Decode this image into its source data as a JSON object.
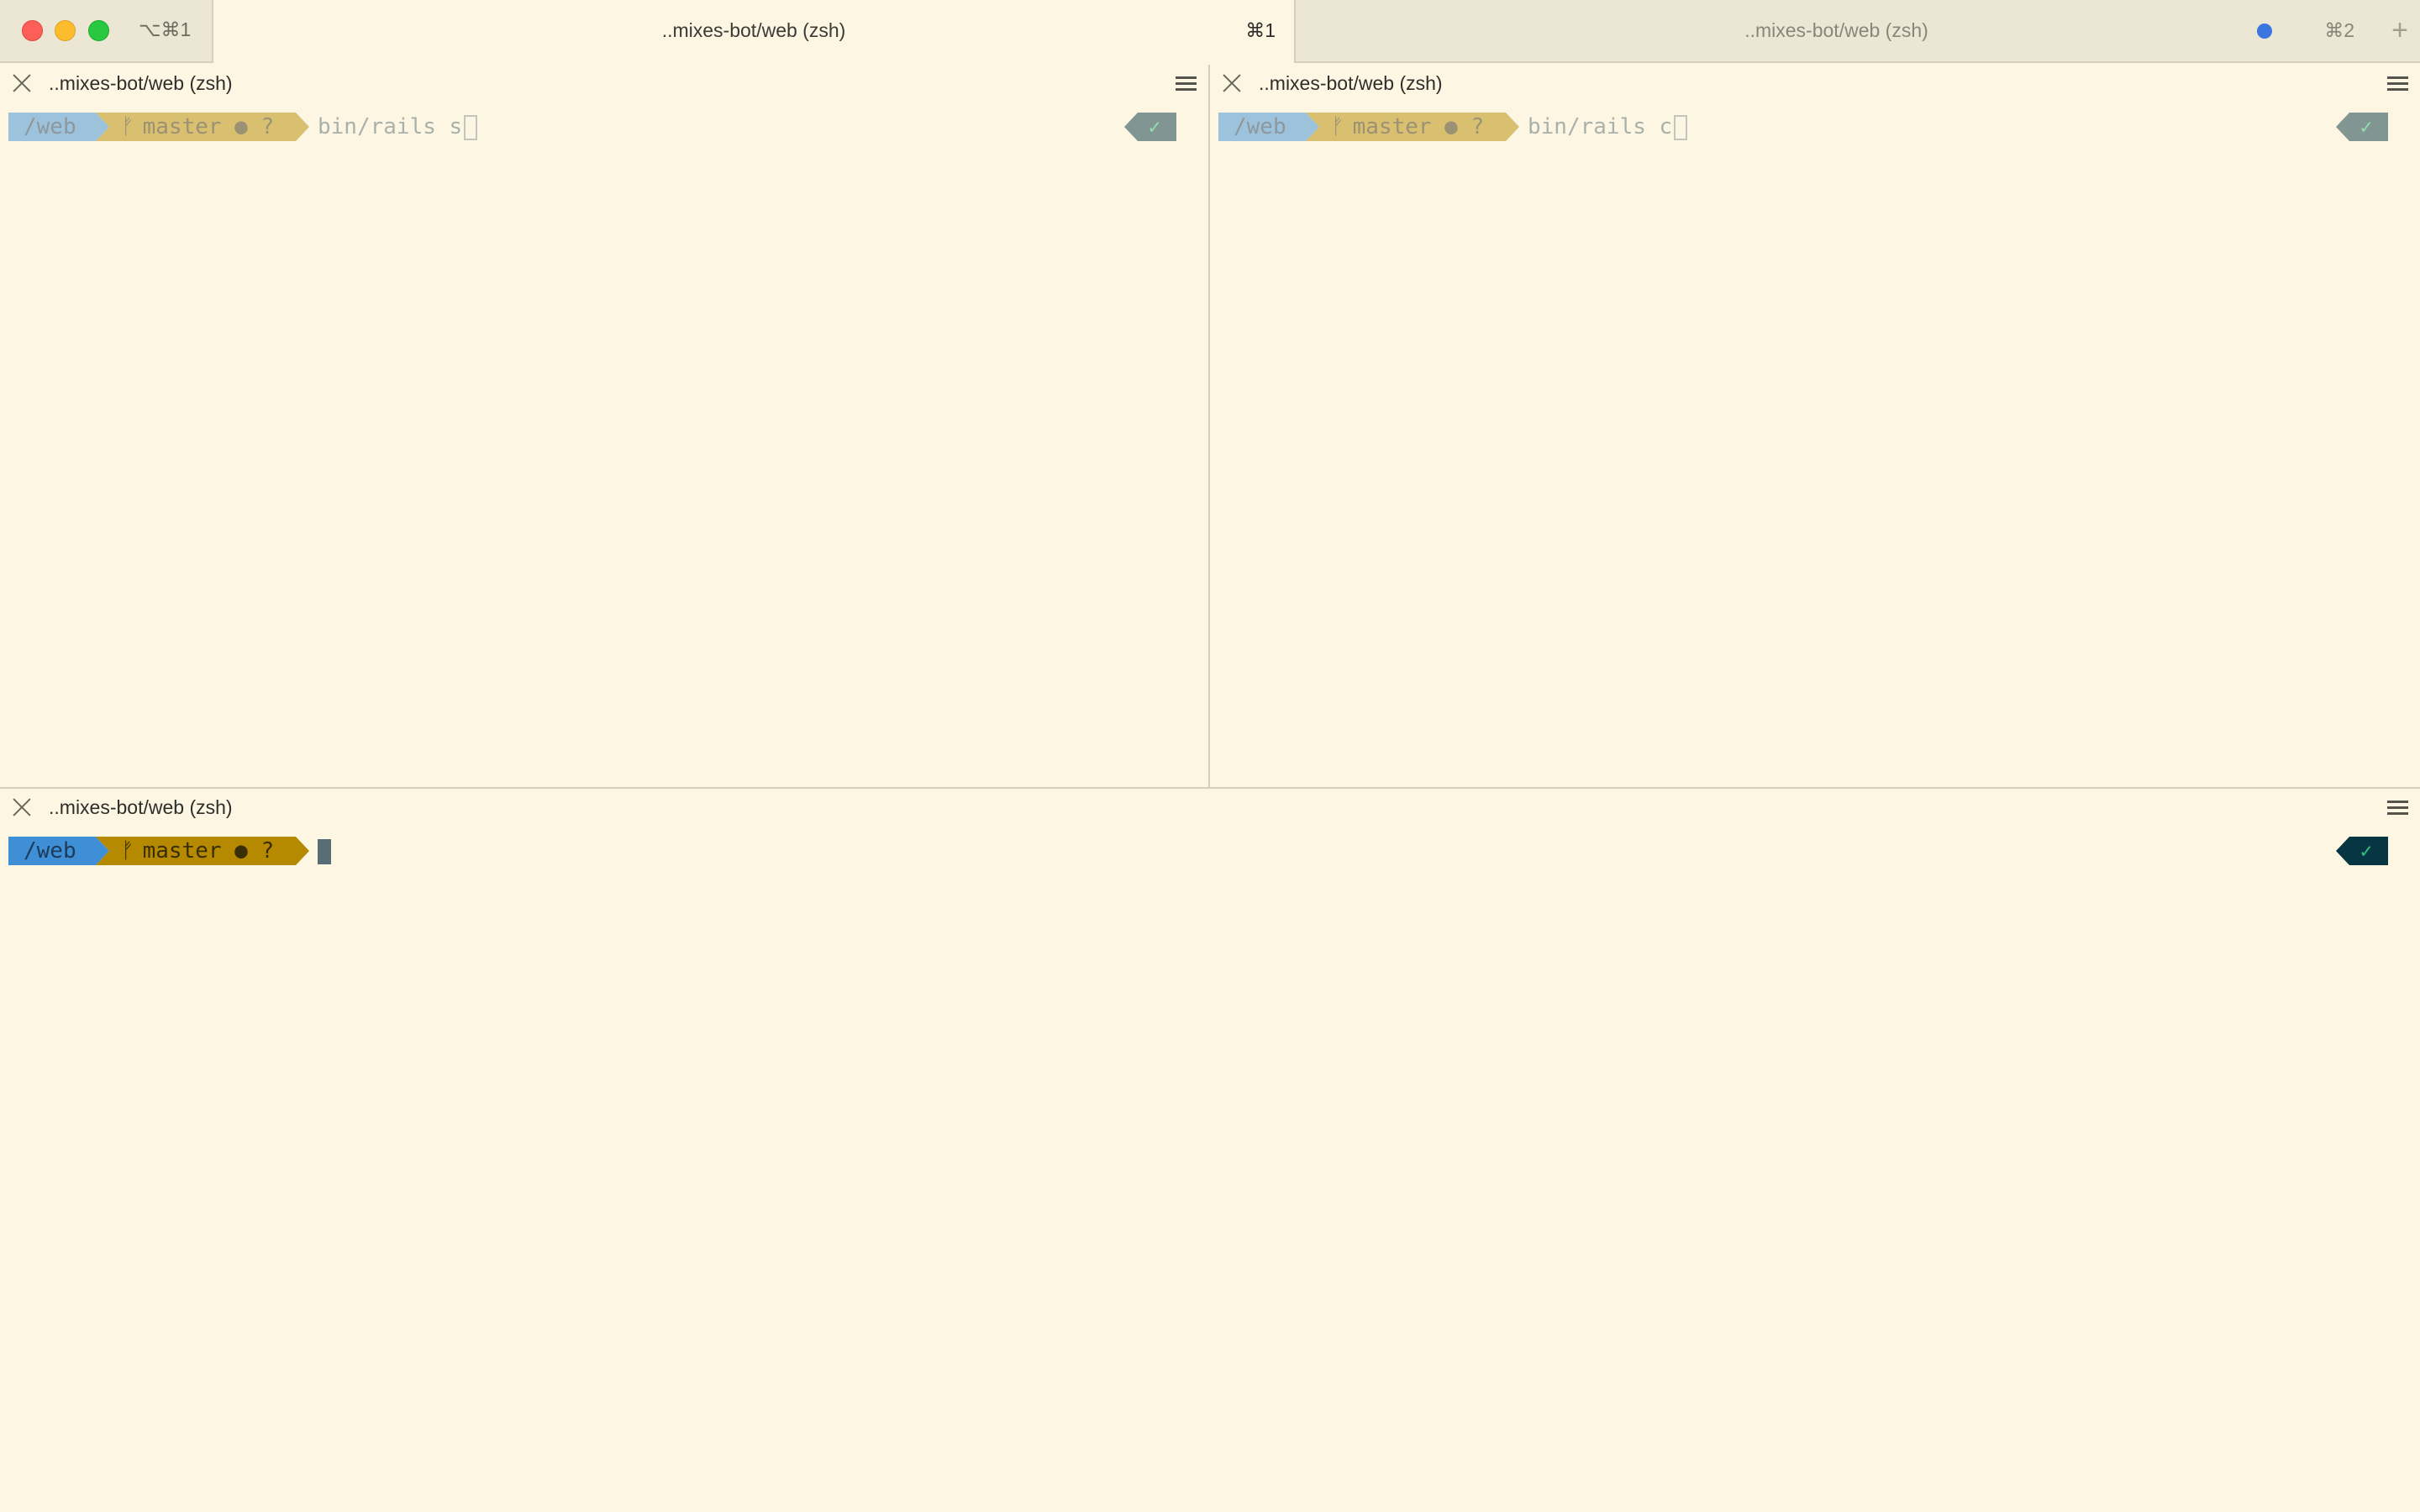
{
  "window": {
    "shortcut": "⌥⌘1",
    "tabs": [
      {
        "title": "..mixes-bot/web (zsh)",
        "shortcut": "⌘1"
      },
      {
        "title": "..mixes-bot/web (zsh)",
        "shortcut": "⌘2"
      }
    ],
    "new_tab_label": "+"
  },
  "panes": [
    {
      "title": "..mixes-bot/web (zsh)",
      "prompt": {
        "dir": "/web",
        "branch_icon": "ᚠ",
        "git": "master ● ?",
        "command": "bin/rails s",
        "status": "✓"
      }
    },
    {
      "title": "..mixes-bot/web (zsh)",
      "prompt": {
        "dir": "/web",
        "branch_icon": "ᚠ",
        "git": "master ● ?",
        "command": "bin/rails c",
        "status": "✓"
      }
    },
    {
      "title": "..mixes-bot/web (zsh)",
      "prompt": {
        "dir": "/web",
        "branch_icon": "ᚠ",
        "git": "master ● ?",
        "command": "",
        "status": "✓"
      }
    }
  ],
  "colors": {
    "background": "#fdf6e3",
    "dir_segment": "#3e8fd6",
    "git_segment": "#b58900",
    "status_segment": "#073642",
    "activity_dot": "#3b75e0"
  }
}
